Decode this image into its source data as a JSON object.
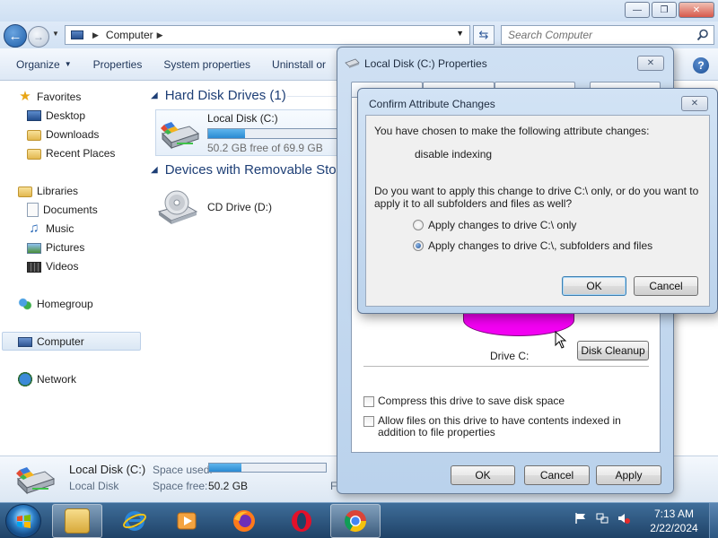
{
  "explorer": {
    "address": {
      "location": "Computer"
    },
    "search": {
      "placeholder": "Search Computer"
    },
    "toolbar": {
      "organize": "Organize",
      "properties": "Properties",
      "system_properties": "System properties",
      "uninstall": "Uninstall or"
    },
    "nav": {
      "favorites": "Favorites",
      "desktop": "Desktop",
      "downloads": "Downloads",
      "recent_places": "Recent Places",
      "libraries": "Libraries",
      "documents": "Documents",
      "music": "Music",
      "pictures": "Pictures",
      "videos": "Videos",
      "homegroup": "Homegroup",
      "computer": "Computer",
      "network": "Network"
    },
    "content": {
      "hard_drives_heading": "Hard Disk Drives (1)",
      "local_disk_name": "Local Disk (C:)",
      "local_disk_free": "50.2 GB free of 69.9 GB",
      "local_disk_used_fraction": 0.28,
      "removable_heading": "Devices with Removable Stor",
      "cd_drive_name": "CD Drive (D:)"
    },
    "details": {
      "name": "Local Disk (C:)",
      "type": "Local Disk",
      "space_used_label": "Space used:",
      "space_free_label": "Space free:",
      "space_free_value": "50.2 GB",
      "extra_label": "F",
      "used_fraction": 0.28
    }
  },
  "properties_dialog": {
    "title": "Local Disk (C:) Properties",
    "drive_label": "Drive C:",
    "disk_cleanup": "Disk Cleanup",
    "compress_label": "Compress this drive to save disk space",
    "allow_indexing_label": "Allow files on this drive to have contents indexed in addition to file properties",
    "ok": "OK",
    "cancel": "Cancel",
    "apply": "Apply",
    "pie_color": "#f200f2"
  },
  "confirm_dialog": {
    "title": "Confirm Attribute Changes",
    "intro": "You have chosen to make the following attribute changes:",
    "change": "disable indexing",
    "question": "Do you want to apply this change to drive C:\\ only, or do you want to apply it to all subfolders and files as well?",
    "option_drive_only": "Apply changes to drive C:\\ only",
    "option_all": "Apply changes to drive C:\\, subfolders and files",
    "selected_option": "option_all",
    "ok": "OK",
    "cancel": "Cancel"
  },
  "taskbar": {
    "time": "7:13 AM",
    "date": "2/22/2024",
    "apps": [
      "file-explorer-icon",
      "internet-explorer-icon",
      "media-player-icon",
      "firefox-icon",
      "opera-icon",
      "chrome-icon"
    ]
  }
}
